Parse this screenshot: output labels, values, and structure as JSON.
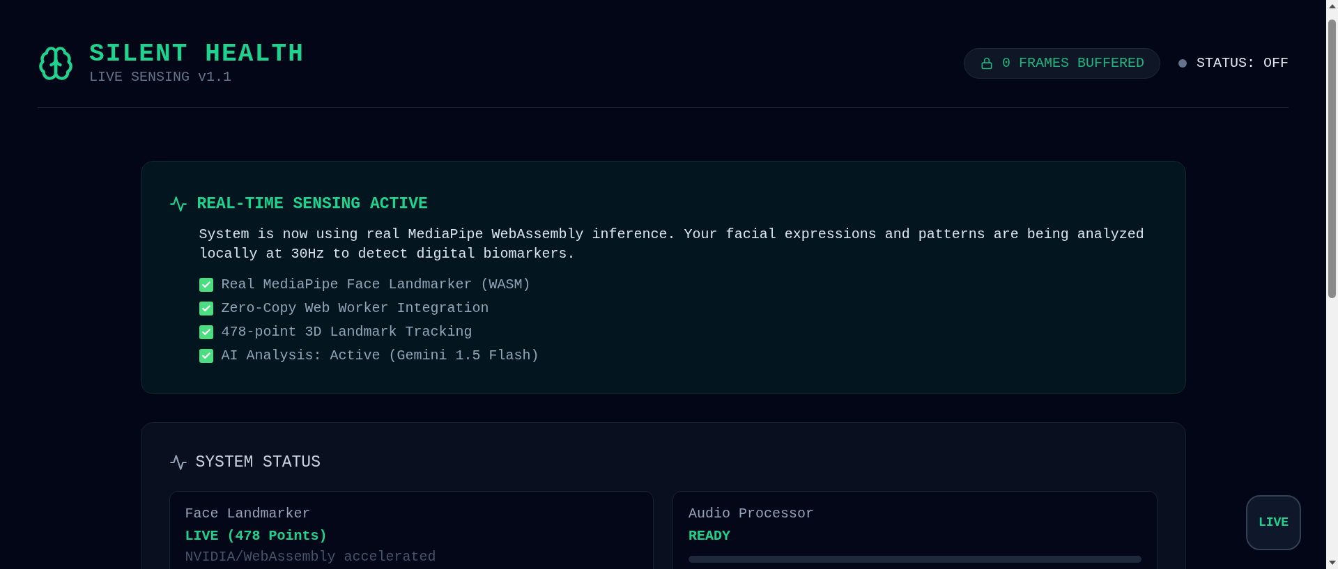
{
  "header": {
    "title": "SILENT HEALTH",
    "subtitle": "LIVE SENSING v1.1",
    "frames_badge": "0 FRAMES BUFFERED",
    "status": {
      "label": "STATUS: OFF",
      "on": false
    }
  },
  "banner": {
    "title": "REAL-TIME SENSING ACTIVE",
    "text": "System is now using real MediaPipe WebAssembly inference. Your facial expressions and patterns are being analyzed locally at 30Hz to detect digital biomarkers.",
    "features": [
      {
        "label": "Real MediaPipe Face Landmarker (WASM)",
        "checked": true
      },
      {
        "label": "Zero-Copy Web Worker Integration",
        "checked": true
      },
      {
        "label": "478-point 3D Landmark Tracking",
        "checked": true
      },
      {
        "label": "AI Analysis: Active (Gemini 1.5 Flash)",
        "checked": true
      }
    ]
  },
  "system_status": {
    "title": "SYSTEM STATUS",
    "modules": [
      {
        "kind": "text",
        "name": "Face Landmarker",
        "state": "LIVE (478 Points)",
        "detail": "NVIDIA/WebAssembly accelerated"
      },
      {
        "kind": "meter",
        "name": "Audio Processor",
        "state": "READY",
        "level": 0
      }
    ]
  },
  "live_button": "LIVE"
}
